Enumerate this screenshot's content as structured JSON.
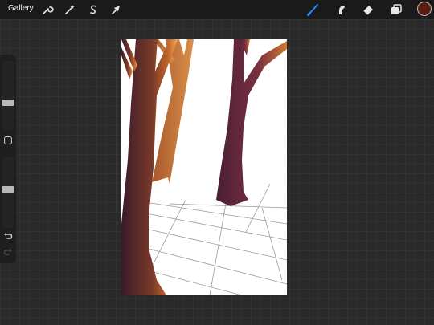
{
  "topbar": {
    "gallery_label": "Gallery",
    "actions": [
      {
        "name": "actions-wrench-icon"
      },
      {
        "name": "adjustments-wand-icon"
      },
      {
        "name": "selection-s-icon"
      },
      {
        "name": "transform-arrow-icon"
      }
    ],
    "tools": [
      {
        "name": "brush-icon",
        "active": true
      },
      {
        "name": "smudge-icon",
        "active": false
      },
      {
        "name": "eraser-icon",
        "active": false
      },
      {
        "name": "layers-icon",
        "active": false
      }
    ],
    "current_color": "#5a1d14",
    "active_tool_color": "#1e8cff"
  },
  "sidebar": {
    "brush_size_level": 0.62,
    "opacity_level": 0.45,
    "modify_button": "square-modify-icon",
    "undo_icon": "undo-icon",
    "redo_icon": "redo-icon"
  },
  "canvas": {
    "background": "#ffffff",
    "tree_dark": "#5c2230",
    "tree_light": "#c47a3a",
    "grid_line_color": "#9a9a9a"
  }
}
